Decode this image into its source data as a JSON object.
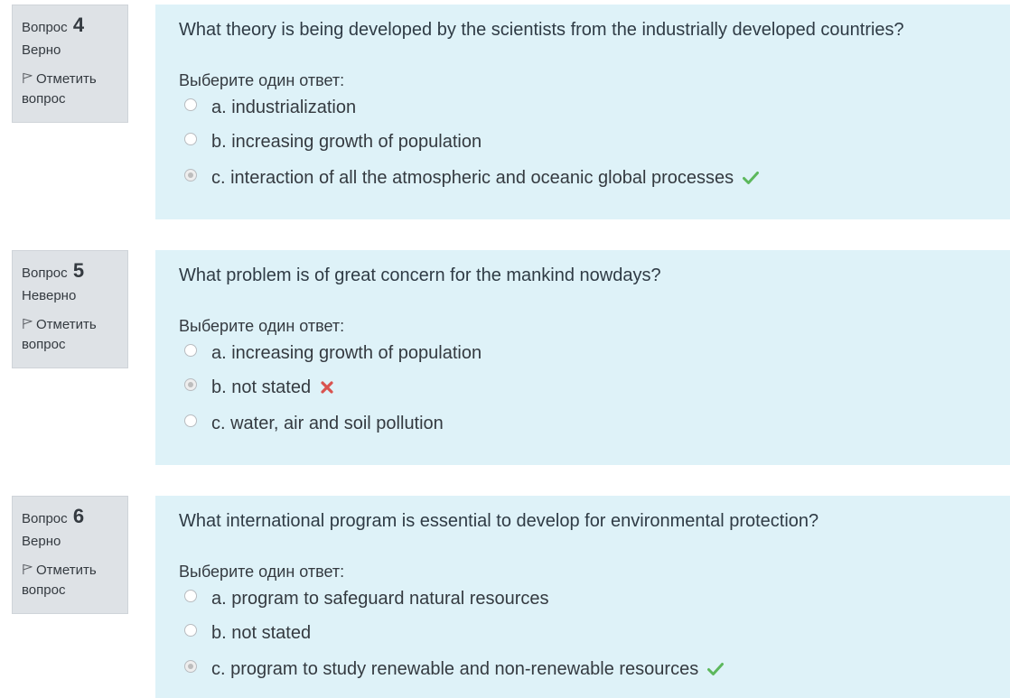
{
  "questions": [
    {
      "label": "Вопрос",
      "number": "4",
      "state": "Верно",
      "flag_label": "Отметить вопрос",
      "text": "What theory is being developed by the scientists from the industrially developed countries?",
      "prompt": "Выберите один ответ:",
      "answers": [
        {
          "text": "a. industrialization",
          "selected": false,
          "mark": "none"
        },
        {
          "text": "b. increasing growth of population",
          "selected": false,
          "mark": "none"
        },
        {
          "text": "c. interaction of all the atmospheric and oceanic global processes",
          "selected": true,
          "mark": "correct"
        }
      ]
    },
    {
      "label": "Вопрос",
      "number": "5",
      "state": "Неверно",
      "flag_label": "Отметить вопрос",
      "text": "What problem is of great concern for the mankind nowdays?",
      "prompt": "Выберите один ответ:",
      "answers": [
        {
          "text": "a. increasing growth of population",
          "selected": false,
          "mark": "none"
        },
        {
          "text": "b. not stated",
          "selected": true,
          "mark": "incorrect"
        },
        {
          "text": "c. water, air and soil pollution",
          "selected": false,
          "mark": "none"
        }
      ]
    },
    {
      "label": "Вопрос",
      "number": "6",
      "state": "Верно",
      "flag_label": "Отметить вопрос",
      "text": "What international program is essential to develop for environmental protection?",
      "prompt": "Выберите один ответ:",
      "answers": [
        {
          "text": "a. program to safeguard natural resources",
          "selected": false,
          "mark": "none"
        },
        {
          "text": "b. not stated",
          "selected": false,
          "mark": "none"
        },
        {
          "text": "c. program to study renewable and non-renewable resources",
          "selected": true,
          "mark": "correct"
        }
      ]
    }
  ],
  "icons": {
    "flag": "flag-icon",
    "correct": "check-icon",
    "incorrect": "cross-icon"
  },
  "colors": {
    "info_bg": "#dee2e6",
    "content_bg": "#def2f8",
    "correct": "#5cb85c",
    "incorrect": "#d9534f"
  }
}
